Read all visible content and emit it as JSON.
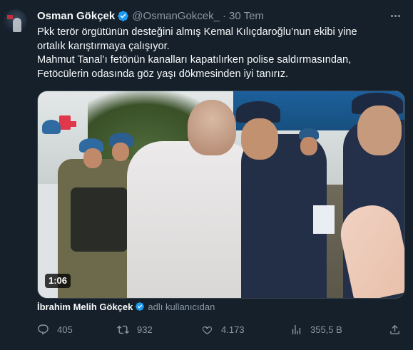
{
  "tweet": {
    "author_name": "Osman Gökçek",
    "handle": "@OsmanGokcek_",
    "separator": "·",
    "time": "30 Tem",
    "lines": [
      "Pkk terör örgütünün desteğini almış Kemal Kılıçdaroğlu’nun ekibi yine",
      "ortalık karıştırmaya çalışıyor.",
      "Mahmut Tanal’ı fetönün kanalları kapatılırken polise saldırmasından,",
      "Fetöcülerin odasında göz yaşı dökmesinden iyi tanırız."
    ]
  },
  "video": {
    "duration": "1:06"
  },
  "attribution": {
    "name": "İbrahim Melih Gökçek",
    "suffix": "adlı kullanıcıdan"
  },
  "actions": {
    "replies": "405",
    "retweets": "932",
    "likes": "4.173",
    "views": "355,5 B"
  },
  "colors": {
    "background": "#15202b",
    "text": "#f7f9f9",
    "secondary": "#8b98a5",
    "verified": "#1d9bf0",
    "border": "#38444d"
  },
  "icons": [
    "verified-badge-icon",
    "more-icon",
    "reply-icon",
    "retweet-icon",
    "like-icon",
    "views-icon",
    "share-icon"
  ]
}
